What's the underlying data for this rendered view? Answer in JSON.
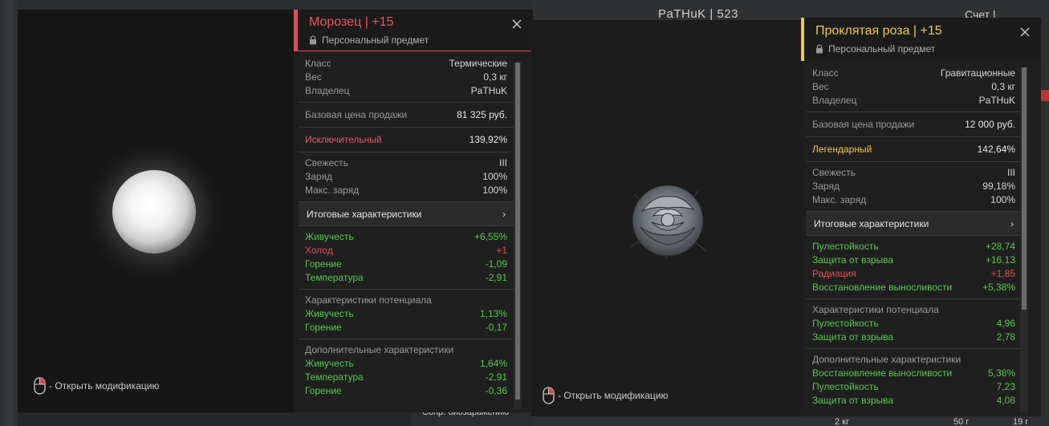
{
  "background": {
    "player_name": "PaTHuK | 523",
    "account_label": "Счет |",
    "bottom_text": "Сопр. биозаражению",
    "bottom_right_1": "2 кг",
    "bottom_right_2": "50 г",
    "bottom_right_3": "19 г"
  },
  "left_preview": {
    "hint": "- Открыть модификацию",
    "icon": "glowing-orb"
  },
  "right_preview": {
    "hint": "- Открыть модификацию",
    "icon": "stone-rose"
  },
  "card1": {
    "title": "Морозец | +15",
    "subtitle": "Персональный предмет",
    "accent": "#e34c56",
    "info": [
      {
        "k": "Класс",
        "v": "Термические"
      },
      {
        "k": "Вес",
        "v": "0,3 кг"
      },
      {
        "k": "Владелец",
        "v": "PaTHuK"
      }
    ],
    "price": {
      "k": "Базовая цена продажи",
      "v": "81 325 руб."
    },
    "rarity": {
      "k": "Исключительный",
      "v": "139,92%"
    },
    "state": [
      {
        "k": "Свежесть",
        "v": "III"
      },
      {
        "k": "Заряд",
        "v": "100%"
      },
      {
        "k": "Макс. заряд",
        "v": "100%"
      }
    ],
    "totals_label": "Итоговые характеристики",
    "totals": [
      {
        "k": "Живучесть",
        "v": "+6,55%",
        "c": "g"
      },
      {
        "k": "Холод",
        "v": "+1",
        "c": "r"
      },
      {
        "k": "Горение",
        "v": "-1,09",
        "c": "g"
      },
      {
        "k": "Температура",
        "v": "-2,91",
        "c": "g"
      }
    ],
    "potential_label": "Характеристики потенциала",
    "potential": [
      {
        "k": "Живучесть",
        "v": "1,13%",
        "c": "g"
      },
      {
        "k": "Горение",
        "v": "-0,17",
        "c": "g"
      }
    ],
    "extra_label": "Дополнительные характеристики",
    "extra": [
      {
        "k": "Живучесть",
        "v": "1,64%",
        "c": "g"
      },
      {
        "k": "Температура",
        "v": "-2,91",
        "c": "g"
      },
      {
        "k": "Горение",
        "v": "-0,36",
        "c": "g"
      }
    ]
  },
  "card2": {
    "title": "Проклятая роза | +15",
    "subtitle": "Персональный предмет",
    "accent": "#f0c64a",
    "info": [
      {
        "k": "Класс",
        "v": "Гравитационные"
      },
      {
        "k": "Вес",
        "v": "0,3 кг"
      },
      {
        "k": "Владелец",
        "v": "PaTHuK"
      }
    ],
    "price": {
      "k": "Базовая цена продажи",
      "v": "12 000 руб."
    },
    "rarity": {
      "k": "Легендарный",
      "v": "142,64%"
    },
    "state": [
      {
        "k": "Свежесть",
        "v": "III"
      },
      {
        "k": "Заряд",
        "v": "99,18%"
      },
      {
        "k": "Макс. заряд",
        "v": "100%"
      }
    ],
    "totals_label": "Итоговые характеристики",
    "totals": [
      {
        "k": "Пулестойкость",
        "v": "+28,74",
        "c": "g"
      },
      {
        "k": "Защита от взрыва",
        "v": "+16,13",
        "c": "g"
      },
      {
        "k": "Радиация",
        "v": "+1,85",
        "c": "r"
      },
      {
        "k": "Восстановление выносливости",
        "v": "+5,38%",
        "c": "g"
      }
    ],
    "potential_label": "Характеристики потенциала",
    "potential": [
      {
        "k": "Пулестойкость",
        "v": "4,96",
        "c": "g"
      },
      {
        "k": "Защита от взрыва",
        "v": "2,78",
        "c": "g"
      }
    ],
    "extra_label": "Дополнительные характеристики",
    "extra": [
      {
        "k": "Восстановление выносливости",
        "v": "5,38%",
        "c": "g"
      },
      {
        "k": "Пулестойкость",
        "v": "7,23",
        "c": "g"
      },
      {
        "k": "Защита от взрыва",
        "v": "4,08",
        "c": "g"
      }
    ]
  }
}
